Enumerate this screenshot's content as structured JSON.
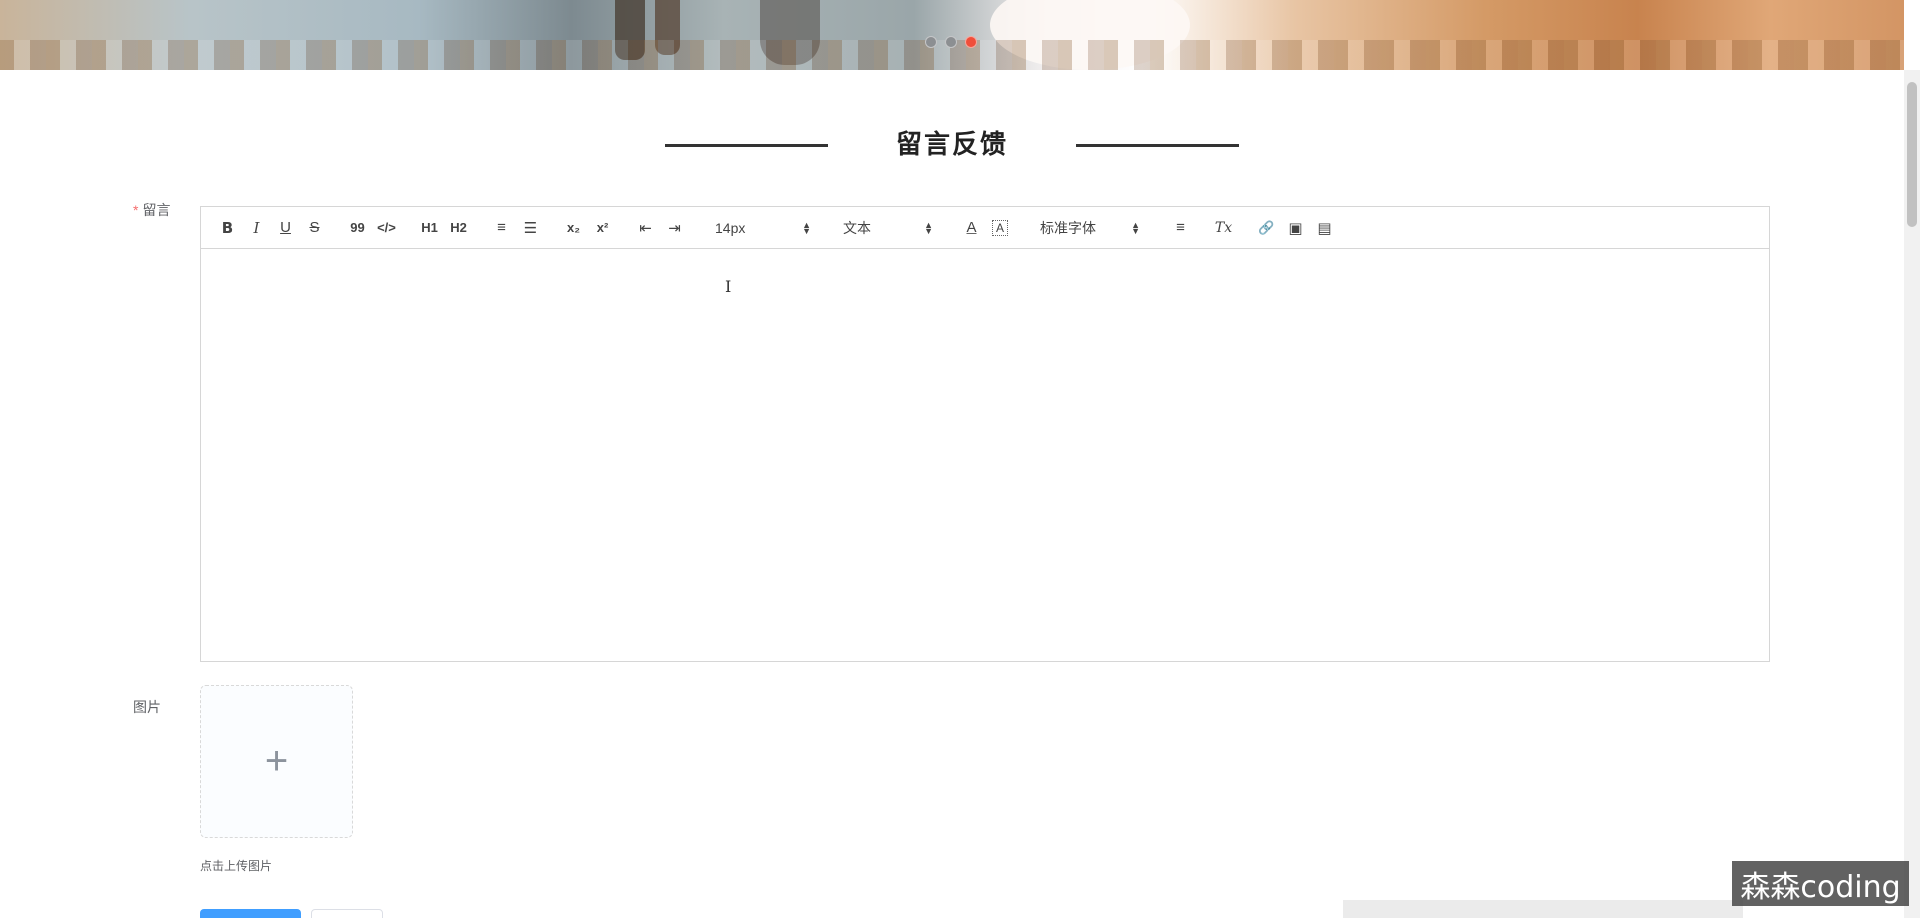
{
  "carousel": {
    "slide_count": 3,
    "active_index": 2,
    "active_color": "#f04e3a",
    "dot_color": "#8c8f92"
  },
  "section": {
    "title": "留言反馈"
  },
  "form": {
    "message_label": "留言",
    "required_mark": "*",
    "image_label": "图片",
    "upload_tip": "点击上传图片",
    "upload_icon": "plus-icon"
  },
  "toolbar": {
    "bold": "B",
    "italic": "I",
    "underline": "U",
    "strike": "S",
    "blockquote": "99",
    "code": "</>",
    "h1": "H1",
    "h2": "H2",
    "ordered_list": "≡",
    "bullet_list": "☰",
    "subscript": "x₂",
    "superscript": "x²",
    "outdent": "⇤",
    "indent": "⇥",
    "font_size": "14px",
    "header_select": "文本",
    "text_color": "A",
    "background_color": "A",
    "font_family": "标准字体",
    "align": "≡",
    "clean": "Tx",
    "link": "🔗",
    "image": "▣",
    "video": "▤"
  },
  "editor": {
    "content": ""
  },
  "colors": {
    "primary": "#409eff",
    "required": "#f56c6c"
  },
  "watermark": "森森coding"
}
